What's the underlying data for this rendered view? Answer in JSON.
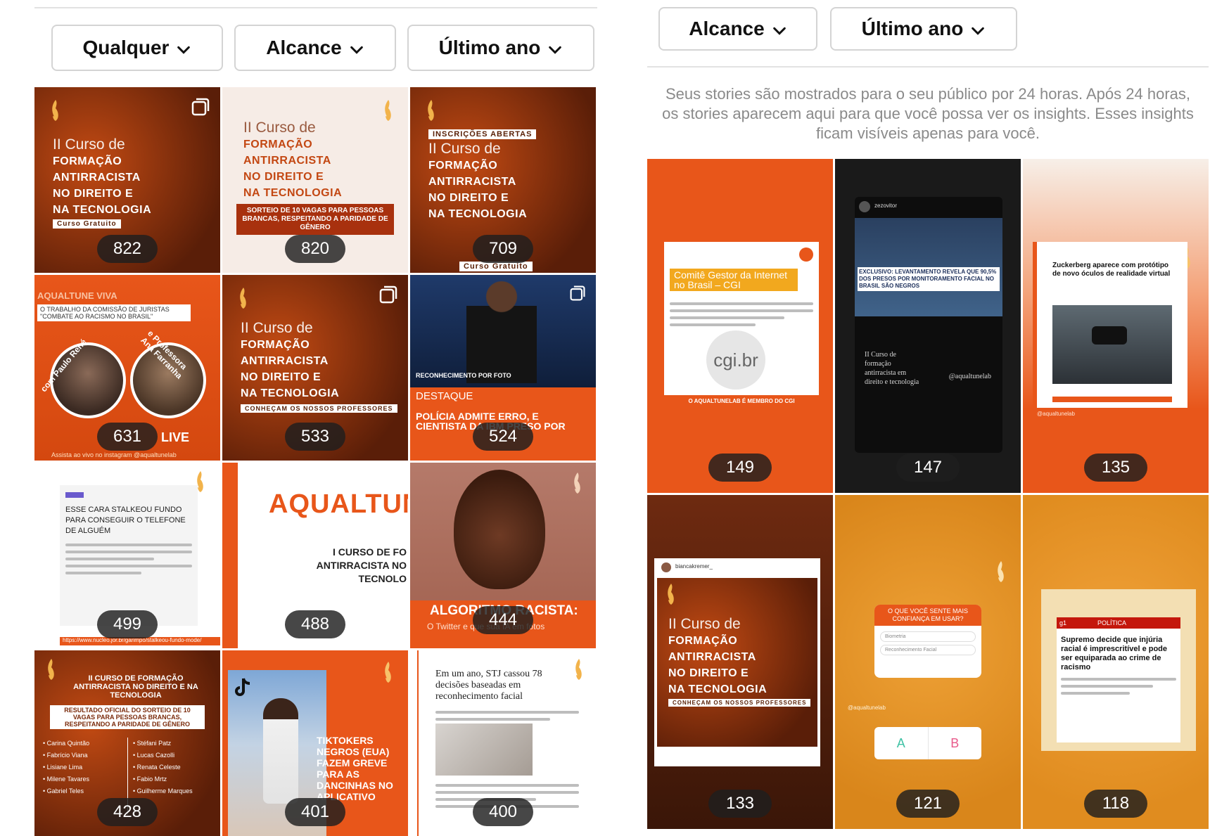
{
  "left": {
    "filters": [
      "Qualquer",
      "Alcance",
      "Último ano"
    ],
    "tiles": [
      {
        "count": "822",
        "kind": "course",
        "top_line": "II Curso de",
        "lines": [
          "FORMAÇÃO",
          "ANTIRRACISTA",
          "NO DIREITO E",
          "NA TECNOLOGIA"
        ],
        "badge": "Curso Gratuito"
      },
      {
        "count": "820",
        "kind": "course-light",
        "top_line": "II Curso de",
        "lines": [
          "FORMAÇÃO",
          "ANTIRRACISTA",
          "NO DIREITO E",
          "NA TECNOLOGIA"
        ],
        "banner": "SORTEIO DE 10 VAGAS PARA PESSOAS BRANCAS, RESPEITANDO A PARIDADE DE GÊNERO"
      },
      {
        "count": "709",
        "kind": "course",
        "top_badge": "INSCRIÇÕES ABERTAS",
        "top_line": "II Curso de",
        "lines": [
          "FORMAÇÃO",
          "ANTIRRACISTA",
          "NO DIREITO E",
          "NA TECNOLOGIA"
        ],
        "badge": "Curso Gratuito"
      },
      {
        "count": "631",
        "kind": "live",
        "header": "AQUALTUNE VIVA",
        "subheader": "O TRABALHO DA COMISSÃO DE JURISTAS \"COMBATE AO RACISMO NO BRASIL\"",
        "name_a": "com Paulo René",
        "name_b": "e Professora Ana Farranha",
        "live": "LIVE",
        "footer": "Assista ao vivo no instagram @aqualtunelab"
      },
      {
        "count": "533",
        "kind": "course",
        "top_line": "II Curso de",
        "lines": [
          "FORMAÇÃO",
          "ANTIRRACISTA",
          "NO DIREITO E",
          "NA TECNOLOGIA"
        ],
        "badge": "CONHEÇAM OS NOSSOS PROFESSORES"
      },
      {
        "count": "524",
        "kind": "news-photo",
        "photo_caption": "RECONHECIMENTO POR FOTO",
        "tag": "DESTAQUE",
        "headline": "POLÍCIA ADMITE ERRO, E CIENTISTA DA IBM PRESO POR"
      },
      {
        "count": "499",
        "kind": "article",
        "headline": "ESSE CARA STALKEOU FUNDO PARA CONSEGUIR O TELEFONE DE ALGUÉM",
        "footer": "https://www.nucleo.jor.br/garimpo/stalkeou-fundo-mode/"
      },
      {
        "count": "488",
        "kind": "brand",
        "brand": "AQUALTUN",
        "lines": [
          "I CURSO DE FO",
          "ANTIRRACISTA NO",
          "TECNOLO"
        ]
      },
      {
        "count": "444",
        "kind": "face",
        "headline": "ALGORITMO RACISTA:",
        "sub": "O Twitter e que sua IA em fotos"
      },
      {
        "count": "428",
        "kind": "result",
        "title": "II CURSO DE FORMAÇÃO ANTIRRACISTA NO DIREITO E NA TECNOLOGIA",
        "box": "RESULTADO OFICIAL DO SORTEIO DE 10 VAGAS PARA PESSOAS BRANCAS, RESPEITANDO A PARIDADE DE GÊNERO",
        "names_left": [
          "• Carina Quintão",
          "• Fabrício Viana",
          "• Lisiane Lima",
          "• Milene Tavares",
          "• Gabriel Teles"
        ],
        "names_right": [
          "• Stéfani Patz",
          "• Lucas Cazolli",
          "• Renata Celeste",
          "• Fabio Mrtz",
          "• Guilherme Marques"
        ]
      },
      {
        "count": "401",
        "kind": "tiktok",
        "headline": "TIKTOKERS NEGROS (EUA) FAZEM GREVE PARA AS DANCINHAS NO APLICATIVO"
      },
      {
        "count": "400",
        "kind": "newspaper",
        "headline": "Em um ano, STJ cassou 78 decisões baseadas em reconhecimento facial"
      }
    ]
  },
  "right": {
    "filters": [
      "Alcance",
      "Último ano"
    ],
    "intro": "Seus stories são mostrados para o seu público por 24 horas. Após 24 horas, os stories aparecem aqui para que você possa ver os insights. Esses insights ficam visíveis apenas para você.",
    "tiles": [
      {
        "count": "149",
        "kind": "cgi",
        "title": "Comitê Gestor da Internet no Brasil – CGI",
        "logo": "cgi.br",
        "footer": "O AQUALTUNELAB É MEMBRO DO CGI"
      },
      {
        "count": "147",
        "kind": "dark-video",
        "headline": "EXCLUSIVO: LEVANTAMENTO REVELA QUE 90,5% DOS PRESOS POR MONITORAMENTO FACIAL NO BRASIL SÃO NEGROS",
        "text": "II Curso de formação antirracista em direito e tecnologia",
        "handle": "@aqualtunelab",
        "user": "zezovitor"
      },
      {
        "count": "135",
        "kind": "vr",
        "headline": "Zuckerberg aparece com protótipo de novo óculos de realidade virtual",
        "handle": "@aqualtunelab"
      },
      {
        "count": "133",
        "kind": "repost",
        "user": "biancakremer_",
        "top_line": "II Curso de",
        "lines": [
          "FORMAÇÃO",
          "ANTIRRACISTA",
          "NO DIREITO E",
          "NA TECNOLOGIA"
        ],
        "badge": "CONHEÇAM OS NOSSOS PROFESSORES"
      },
      {
        "count": "121",
        "kind": "poll",
        "question": "O QUE VOCÊ SENTE MAIS CONFIANÇA EM USAR?",
        "opt1": "Biometria",
        "opt2": "Reconhecimento Facial",
        "a": "A",
        "b": "B",
        "handle": "@aqualtunelab"
      },
      {
        "count": "118",
        "kind": "g1",
        "logo": "g1",
        "section": "POLÍTICA",
        "headline": "Supremo decide que injúria racial é imprescritível e pode ser equiparada ao crime de racismo"
      }
    ]
  },
  "colors": {
    "orange": "#e8561a",
    "dark_orange": "#b8410f",
    "brown": "#6e2a10",
    "amber": "#e79a24"
  }
}
